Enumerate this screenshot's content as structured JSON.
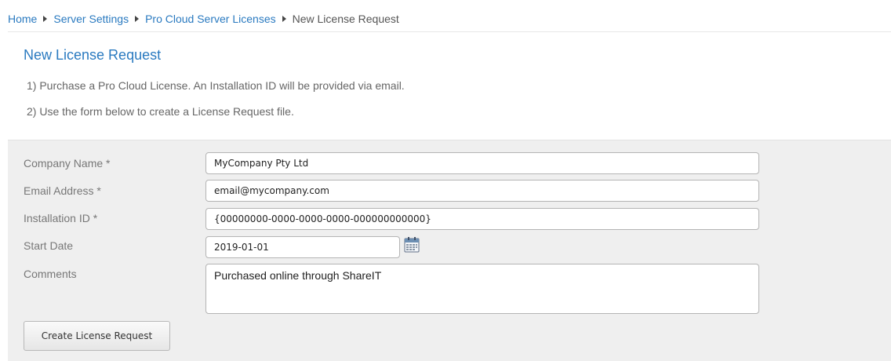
{
  "breadcrumb": {
    "items": [
      "Home",
      "Server Settings",
      "Pro Cloud Server Licenses"
    ],
    "current": "New License Request"
  },
  "page": {
    "title": "New License Request",
    "steps": [
      "1) Purchase a Pro Cloud License. An Installation ID will be provided via email.",
      "2) Use the form below to create a License Request file."
    ]
  },
  "form": {
    "company_name": {
      "label": "Company Name *",
      "value": "MyCompany Pty Ltd"
    },
    "email_address": {
      "label": "Email Address *",
      "value": "email@mycompany.com"
    },
    "installation_id": {
      "label": "Installation ID *",
      "value": "{00000000-0000-0000-0000-000000000000}"
    },
    "start_date": {
      "label": "Start Date",
      "value": "2019-01-01",
      "icon": "calendar-icon"
    },
    "comments": {
      "label": "Comments",
      "value": "Purchased online through ShareIT"
    },
    "submit_label": "Create License Request"
  },
  "colors": {
    "link": "#2a7ac0",
    "panel_background": "#efefef"
  }
}
